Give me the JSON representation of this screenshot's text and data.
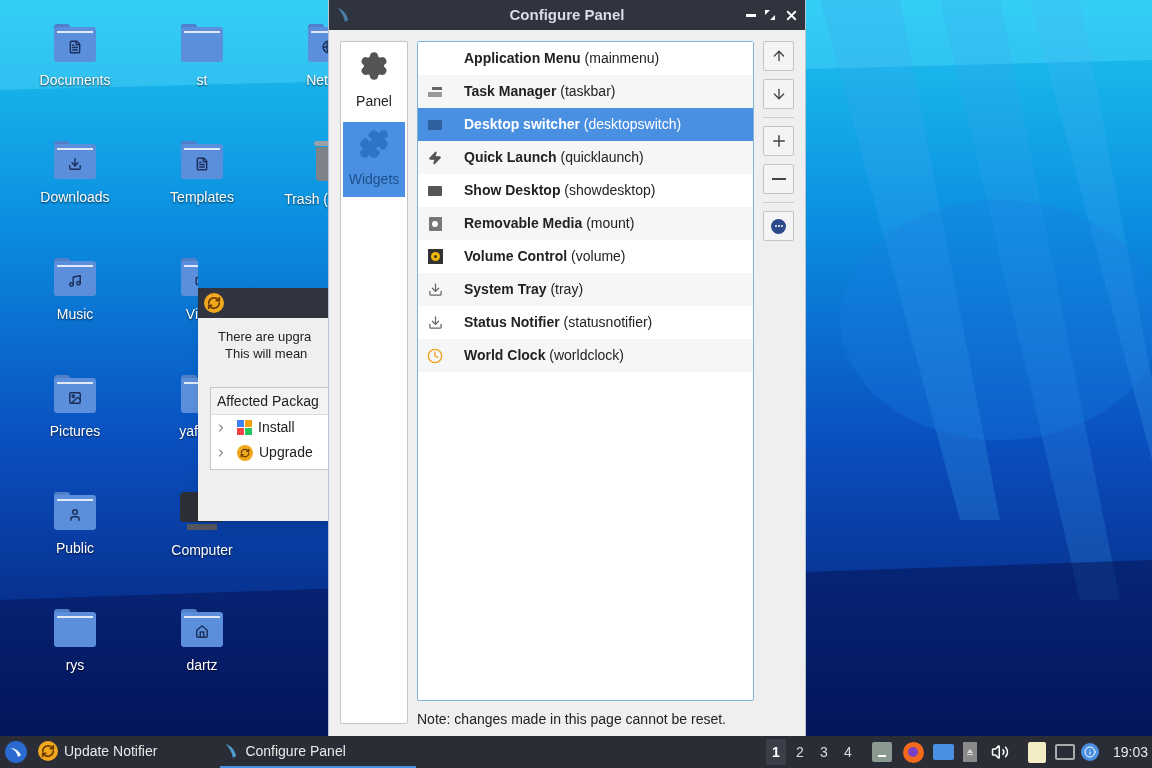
{
  "desktop": {
    "icons": [
      {
        "label": "Documents",
        "kind": "folder"
      },
      {
        "label": "Downloads",
        "kind": "folder"
      },
      {
        "label": "Music",
        "kind": "folder"
      },
      {
        "label": "Pictures",
        "kind": "folder"
      },
      {
        "label": "Public",
        "kind": "folder"
      },
      {
        "label": "rys",
        "kind": "folder"
      },
      {
        "label": "st",
        "kind": "folder"
      },
      {
        "label": "Templates",
        "kind": "folder"
      },
      {
        "label": "Vi",
        "kind": "folder"
      },
      {
        "label": "yaf",
        "kind": "folder"
      },
      {
        "label": "Computer",
        "kind": "computer"
      },
      {
        "label": "dartz",
        "kind": "folder"
      },
      {
        "label": "Net",
        "kind": "folder"
      },
      {
        "label": "Trash (",
        "kind": "trash"
      }
    ]
  },
  "update_dialog": {
    "message_lines": [
      "There are upgra",
      "This will mean"
    ],
    "packages": {
      "header": "Affected Packag",
      "children": [
        {
          "label": "Install",
          "expanded": false
        },
        {
          "label": "Upgrade",
          "expanded": false
        }
      ]
    }
  },
  "configure_panel": {
    "title": "Configure Panel",
    "pages": [
      {
        "label": "Panel",
        "selected": false
      },
      {
        "label": "Widgets",
        "selected": true
      }
    ],
    "widgets": [
      {
        "text": "**Application Menu** (mainmenu)",
        "selected": false
      },
      {
        "text": "**Task Manager** (taskbar)",
        "selected": false
      },
      {
        "text": "**Desktop switcher** (desktopswitch)",
        "selected": true
      },
      {
        "text": "**Quick Launch** (quicklaunch)",
        "selected": false
      },
      {
        "text": "**Show Desktop** (showdesktop)",
        "selected": false
      },
      {
        "text": "**Removable Media** (mount)",
        "selected": false
      },
      {
        "text": "**Volume Control** (volume)",
        "selected": false
      },
      {
        "text": "**System Tray** (tray)",
        "selected": false
      },
      {
        "text": "**Status Notifier** (statusnotifier)",
        "selected": false
      },
      {
        "text": "**World Clock** (worldclock)",
        "selected": false
      }
    ],
    "note": "Note: changes made in this page cannot be reset."
  },
  "taskbar": {
    "tasks": [
      {
        "label": "Update Notifier",
        "selected": false
      },
      {
        "label": "Configure Panel",
        "selected": true
      }
    ],
    "desktops": [
      {
        "label": "1",
        "selected": true
      },
      {
        "label": "2",
        "selected": false
      },
      {
        "label": "3",
        "selected": false
      },
      {
        "label": "4",
        "selected": false
      }
    ],
    "clock": "19:03"
  }
}
